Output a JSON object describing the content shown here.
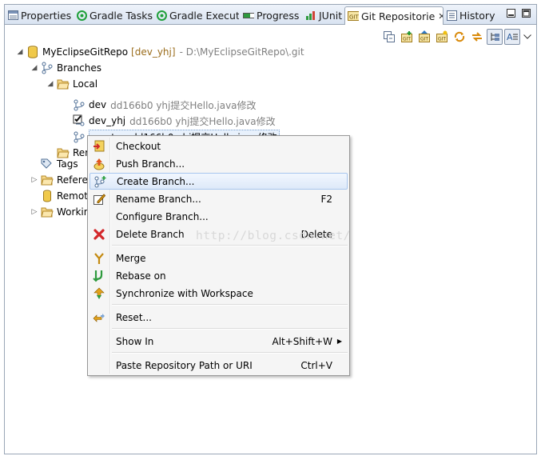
{
  "tabs": [
    {
      "label": "Properties",
      "icon": "properties-icon",
      "active": false
    },
    {
      "label": "Gradle Tasks",
      "icon": "gradle-icon",
      "active": false
    },
    {
      "label": "Gradle Executi",
      "icon": "gradle-icon",
      "active": false
    },
    {
      "label": "Progress",
      "icon": "progress-icon",
      "active": false
    },
    {
      "label": "JUnit",
      "icon": "junit-icon",
      "active": false
    },
    {
      "label": "Git Repositorie",
      "icon": "git-repo-icon",
      "active": true
    },
    {
      "label": "History",
      "icon": "history-icon",
      "active": false
    }
  ],
  "tree": {
    "repo": {
      "name": "MyEclipseGitRepo",
      "branch": "[dev_yhj]",
      "path": "- D:\\MyEclipseGitRepo\\.git"
    },
    "branches_label": "Branches",
    "local_label": "Local",
    "local_branches": [
      {
        "name": "dev",
        "info": "dd166b0 yhj提交Hello.java修改"
      },
      {
        "name": "dev_yhj",
        "info": "dd166b0 yhj提交Hello.java修改"
      },
      {
        "name": "master",
        "info": "dd166b0 yhj提交Hello.java修改"
      }
    ],
    "remote_label": "Rer",
    "tags_label": "Tags",
    "references_label": "Refere",
    "remotes_label": "Remot",
    "working_label": "Workin"
  },
  "context_menu": {
    "checkout": "Checkout",
    "push_branch": "Push Branch...",
    "create_branch": "Create Branch...",
    "rename_branch": "Rename Branch...",
    "rename_shortcut": "F2",
    "configure_branch": "Configure Branch...",
    "delete_branch": "Delete Branch",
    "delete_shortcut": "Delete",
    "merge": "Merge",
    "rebase_on": "Rebase on",
    "synchronize": "Synchronize with Workspace",
    "reset": "Reset...",
    "show_in": "Show In",
    "show_in_shortcut": "Alt+Shift+W",
    "paste_path": "Paste Repository Path or URI",
    "paste_shortcut": "Ctrl+V"
  },
  "watermark": "http://blog.csdn.net/",
  "colors": {
    "accent": "#3d6fb6",
    "selection": "#e8f1fc",
    "decoration": "#9a6c1b"
  }
}
